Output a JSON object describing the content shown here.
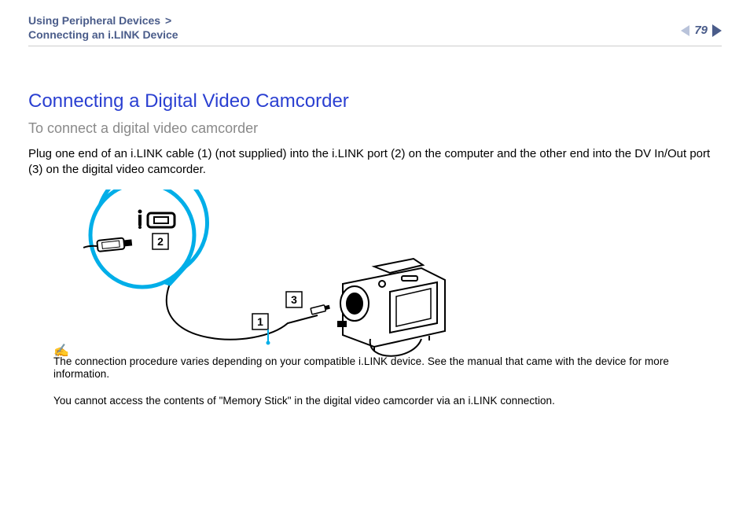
{
  "header": {
    "breadcrumb_line1": "Using Peripheral Devices",
    "breadcrumb_sep": ">",
    "breadcrumb_line2": "Connecting an i.LINK Device",
    "page_number": "79"
  },
  "content": {
    "title": "Connecting a Digital Video Camcorder",
    "subtitle": "To connect a digital video camcorder",
    "lead": "Plug one end of an i.LINK cable (1) (not supplied) into the i.LINK port (2) on the computer and the other end into the DV In/Out port (3) on the digital video camcorder."
  },
  "illustration": {
    "label_1": "1",
    "label_2": "2",
    "label_3": "3"
  },
  "notes": {
    "icon": "✍",
    "line1": "The connection procedure varies depending on your compatible i.LINK device. See the manual that came with the device for more information.",
    "line2": "You cannot access the contents of \"Memory Stick\" in the digital video camcorder via an i.LINK connection."
  }
}
